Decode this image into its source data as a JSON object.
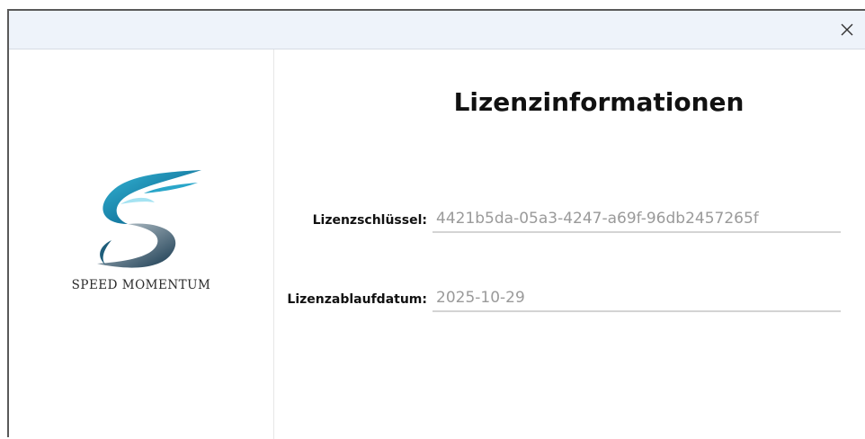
{
  "window": {
    "close_icon": "close-icon"
  },
  "branding": {
    "logo_icon": "speed-momentum-logo",
    "brand_name": "SPEED MOMENTUM"
  },
  "license": {
    "title": "Lizenzinformationen",
    "key_label": "Lizenzschlüssel:",
    "key_value": "4421b5da-05a3-4247-a69f-96db2457265f",
    "expiry_label": "Lizenzablaufdatum:",
    "expiry_value": "2025-10-29"
  },
  "colors": {
    "titlebar": "#eef3fa",
    "logo_teal": "#1f8fb0",
    "logo_dark": "#0e3550",
    "value_text": "#9a9a9a"
  }
}
